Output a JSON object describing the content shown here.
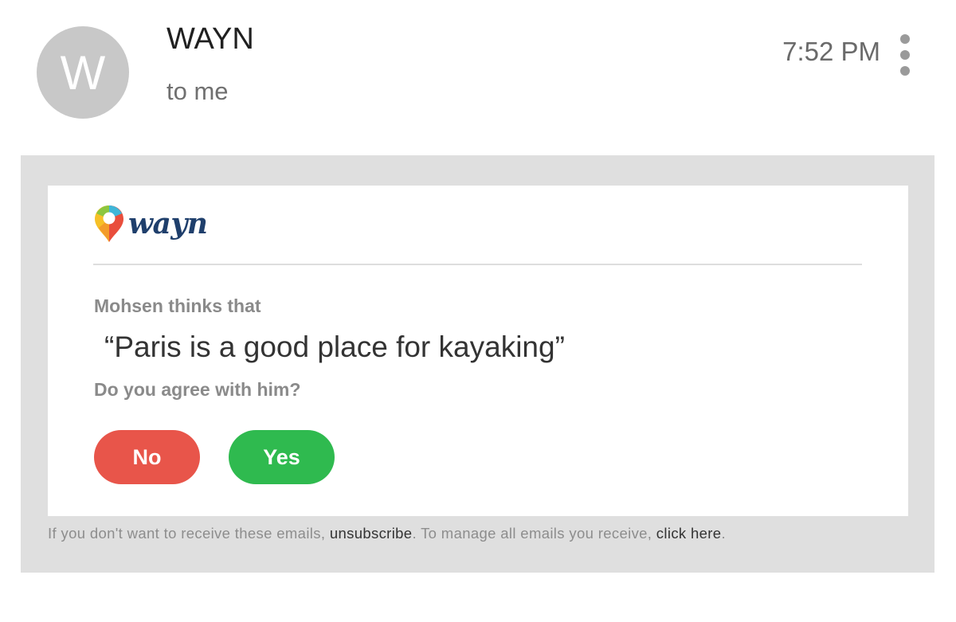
{
  "header": {
    "avatar_letter": "W",
    "sender": "WAYN",
    "recipient": "to me",
    "time": "7:52 PM",
    "more_icon": "more-vertical-icon"
  },
  "email": {
    "logo": {
      "text": "wayn",
      "icon": "map-pin-icon",
      "colors": [
        "#f6c026",
        "#e94e3c",
        "#3fb6d8",
        "#8cc63f"
      ]
    },
    "intro": "Mohsen thinks that",
    "quote": "“Paris is a good place for kayaking”",
    "question": "Do you agree with him?",
    "buttons": {
      "no": "No",
      "yes": "Yes"
    },
    "footer": {
      "text_1": "If you don't want to receive these emails, ",
      "unsubscribe": "unsubscribe",
      "text_2": ". To manage all emails you receive, ",
      "click_here": "click here",
      "text_3": "."
    }
  },
  "colors": {
    "no_button": "#e8554a",
    "yes_button": "#2fba4f",
    "logo_text": "#1f3f6c",
    "mail_background": "#dfdfdf"
  }
}
